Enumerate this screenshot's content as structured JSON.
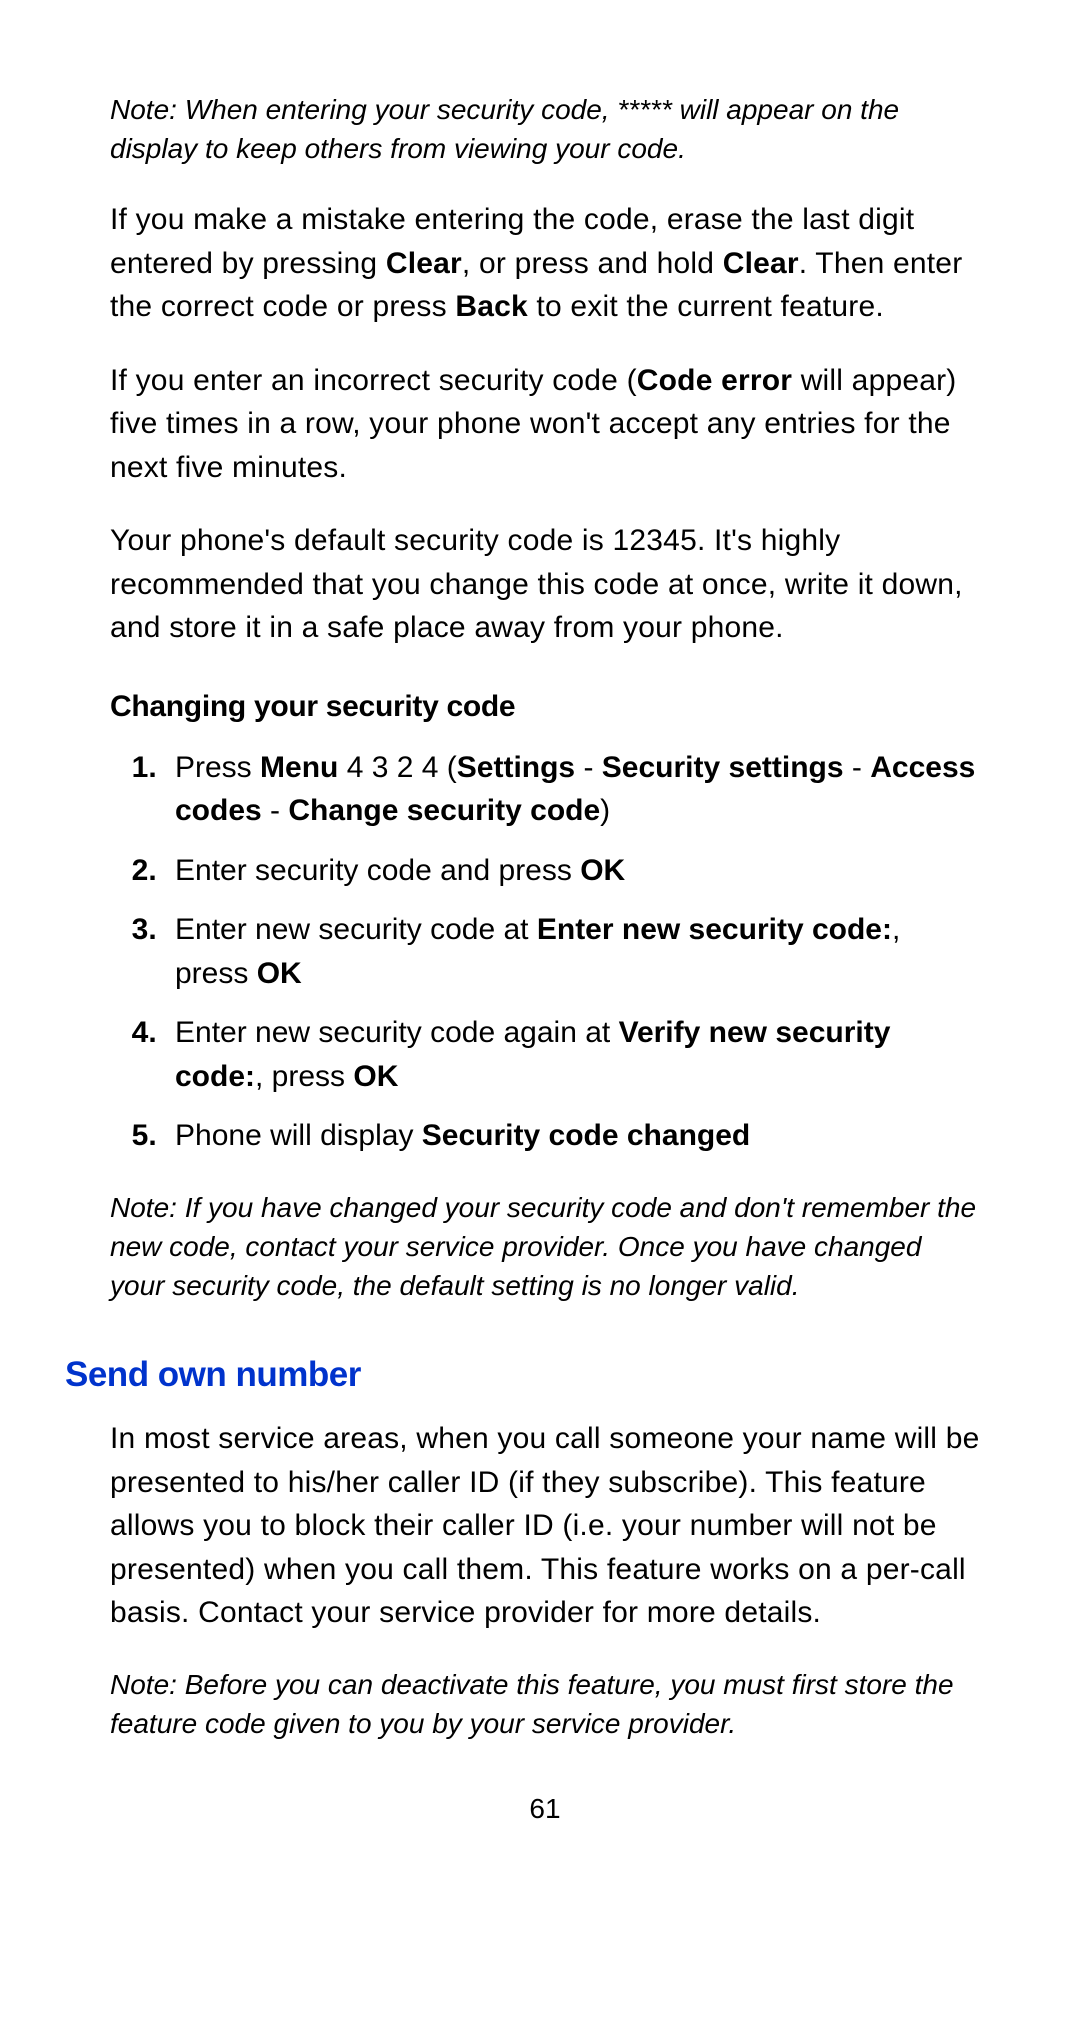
{
  "note_top": "Note: When entering your security code, ***** will appear on the display to keep others from viewing your code.",
  "para1_part1": "If you make a mistake entering the code, erase the last digit entered by pressing ",
  "para1_b1": "Clear",
  "para1_part2": ", or press and hold ",
  "para1_b2": "Clear",
  "para1_part3": ". Then enter the correct code or press ",
  "para1_b3": "Back",
  "para1_part4": " to exit the current feature.",
  "para2_part1": "If you enter an incorrect security code (",
  "para2_b1": "Code error",
  "para2_part2": " will appear) five times in a row, your phone won't accept any entries for the next five minutes.",
  "para3": "Your phone's default security code is 12345. It's highly recommended that you change this code at once, write it down, and store it in a safe place away from your phone.",
  "sub_heading": "Changing your security code",
  "step1_part1": "Press ",
  "step1_b1": "Menu",
  "step1_part2": " 4 3 2 4 (",
  "step1_b2": "Settings",
  "step1_part3": " - ",
  "step1_b3": "Security settings",
  "step1_part4": " - ",
  "step1_b4": "Access codes",
  "step1_part5": " - ",
  "step1_b5": "Change security code",
  "step1_part6": ")",
  "step2_part1": "Enter security code and press ",
  "step2_b1": "OK",
  "step3_part1": "Enter new security code at ",
  "step3_b1": "Enter new security code:",
  "step3_part2": ", press ",
  "step3_b2": "OK",
  "step4_part1": "Enter new security code again at ",
  "step4_b1": "Verify new security code:",
  "step4_part2": ", press ",
  "step4_b2": "OK",
  "step5_part1": "Phone will display ",
  "step5_b1": "Security code changed",
  "note_mid": "Note: If you have changed your security code and don't remember the new code, contact your service provider. Once you have changed your security code, the default setting is no longer valid.",
  "section_heading": "Send own number",
  "para4": "In most service areas, when you call someone your name will be presented to his/her caller ID (if they subscribe). This feature allows you to block their caller ID (i.e. your number will not be presented) when you call them. This feature works on a per-call basis. Contact your service provider for more details.",
  "note_bottom": "Note: Before you can deactivate this feature, you must first store the feature code given to you by your service provider.",
  "page_number": "61"
}
